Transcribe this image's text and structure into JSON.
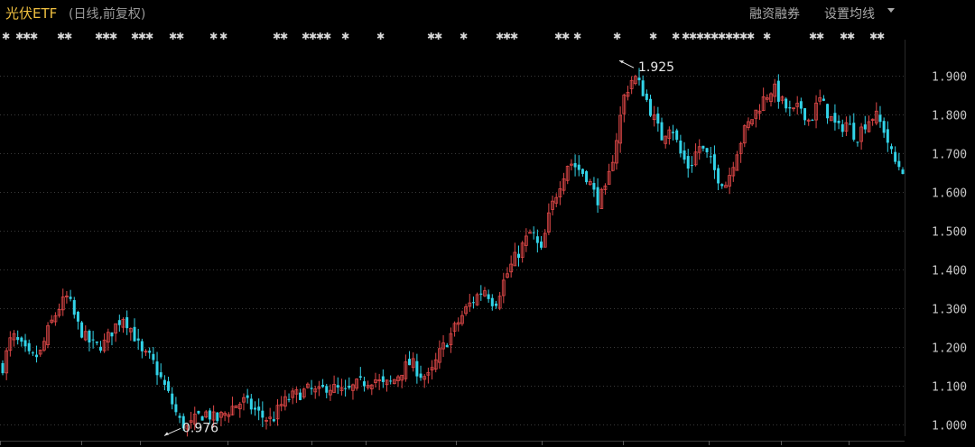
{
  "header": {
    "title": "光伏ETF",
    "subtitle": "(日线,前复权)",
    "margin_button": "融资融券",
    "ma_button": "设置均线"
  },
  "colors": {
    "background": "#000000",
    "up": "#e04848",
    "down": "#32d3e8",
    "grid": "#3a3a3a",
    "title": "#f0c040",
    "event_marks": "#d8d8d8"
  },
  "chart_data": {
    "type": "candlestick",
    "title": "光伏ETF",
    "subtitle": "(日线,前复权)",
    "ylim": [
      0.97,
      1.965
    ],
    "yticks": [
      "1.000",
      "1.100",
      "1.200",
      "1.300",
      "1.400",
      "1.500",
      "1.600",
      "1.700",
      "1.800",
      "1.900"
    ],
    "grid": "horizontal dotted",
    "annotations": [
      {
        "label": "0.976",
        "value": 0.976,
        "at": "low"
      },
      {
        "label": "1.925",
        "value": 1.925,
        "at": "high"
      }
    ],
    "closes": [
      1.15,
      1.23,
      1.2,
      1.17,
      1.18,
      1.25,
      1.3,
      1.33,
      1.26,
      1.22,
      1.2,
      1.21,
      1.25,
      1.28,
      1.24,
      1.18,
      1.17,
      1.12,
      1.07,
      1.01,
      0.99,
      1.02,
      1.03,
      1.01,
      1.03,
      1.05,
      1.06,
      1.04,
      1.02,
      1.01,
      1.05,
      1.07,
      1.08,
      1.09,
      1.08,
      1.1,
      1.09,
      1.08,
      1.1,
      1.11,
      1.12,
      1.1,
      1.11,
      1.14,
      1.16,
      1.13,
      1.12,
      1.18,
      1.22,
      1.26,
      1.3,
      1.33,
      1.35,
      1.31,
      1.37,
      1.42,
      1.46,
      1.5,
      1.44,
      1.55,
      1.62,
      1.68,
      1.66,
      1.64,
      1.58,
      1.6,
      1.72,
      1.85,
      1.9,
      1.86,
      1.8,
      1.74,
      1.78,
      1.7,
      1.66,
      1.72,
      1.69,
      1.64,
      1.62,
      1.7,
      1.76,
      1.8,
      1.84,
      1.87,
      1.83,
      1.8,
      1.82,
      1.78,
      1.84,
      1.8,
      1.76,
      1.78,
      1.74,
      1.78,
      1.8,
      1.76,
      1.68,
      1.66
    ]
  },
  "event_marks": {
    "glyph": "✱"
  }
}
